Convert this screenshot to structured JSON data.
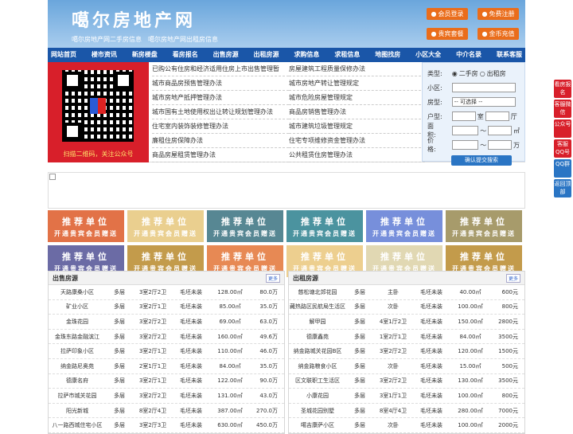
{
  "site": {
    "name": "噶尔房地产网",
    "sub_links": [
      "噶尔房地产网二手房信息",
      "噶尔房地产网出租房信息"
    ]
  },
  "header_buttons": {
    "login": "会员登录",
    "register": "免费注册",
    "vip": "贵宾套餐",
    "recharge": "金币充值"
  },
  "nav": [
    "网站首页",
    "楼市资讯",
    "新房楼盘",
    "看房报名",
    "出售房源",
    "出租房源",
    "求购信息",
    "求租信息",
    "地图找房",
    "小区大全",
    "中介名录",
    "联系客服"
  ],
  "qr": {
    "caption": "扫描二维码，关注公众号"
  },
  "news": [
    "已购公有住房和经济适用住房上市出售管理暂",
    "房屋建筑工程质量保修办法",
    "城市商品房预售管理办法",
    "城市房地产转让管理规定",
    "城市房地产抵押管理办法",
    "城市危险房屋管理规定",
    "城市国有土地使用权出让转让规划管理办法",
    "商品房销售管理办法",
    "住宅室内装饰装修管理办法",
    "城市建筑垃圾管理规定",
    "廉租住房保障办法",
    "住宅专项维修资金管理办法",
    "商品房屋租赁管理办法",
    "公共租赁住房管理办法"
  ],
  "search": {
    "type_label": "类型:",
    "type_sale": "二手房",
    "type_rent": "出租房",
    "community_label": "小区:",
    "house_type_label": "房型:",
    "house_type_value": "-- 可选择 --",
    "layout_label": "户型:",
    "room": "室",
    "hall": "厅",
    "area_label": "面积:",
    "area_unit": "㎡",
    "price_label": "价格:",
    "price_unit": "万",
    "button": "确认提交搜索"
  },
  "ads": {
    "title": "推荐单位",
    "subtitle": "开通贵宾会员赠送",
    "colors": [
      "#d9440a",
      "#e3c06a",
      "#1f5f6f",
      "#0f6f80",
      "#4a6ad0",
      "#8a7a3a",
      "#3a3a88",
      "#b07a10",
      "#e0621b",
      "#e8c06a",
      "#d8cc9a",
      "#b07a10"
    ]
  },
  "sale": {
    "title": "出售房源",
    "more": "更多",
    "rows": [
      [
        "天路康桑小区",
        "多层",
        "3室2厅2卫",
        "毛坯未装",
        "128.00㎡",
        "80.0万"
      ],
      [
        "矿业小区",
        "多层",
        "3室2厅1卫",
        "毛坯未装",
        "85.00㎡",
        "35.0万"
      ],
      [
        "金珠花园",
        "多层",
        "3室2厅2卫",
        "毛坯未装",
        "69.00㎡",
        "63.0万"
      ],
      [
        "金珠东路金融滨江",
        "多层",
        "3室2厅2卫",
        "毛坯未装",
        "160.00㎡",
        "49.6万"
      ],
      [
        "拉萨印象小区",
        "多层",
        "3室2厅1卫",
        "毛坯未装",
        "110.00㎡",
        "46.0万"
      ],
      [
        "纳金路尼奥苑",
        "多层",
        "2室1厅1卫",
        "毛坯未装",
        "84.00㎡",
        "35.0万"
      ],
      [
        "德康名府",
        "多层",
        "3室2厅1卫",
        "毛坯未装",
        "122.00㎡",
        "90.0万"
      ],
      [
        "拉萨市城关花园",
        "多层",
        "3室2厅2卫",
        "毛坯未装",
        "131.00㎡",
        "43.0万"
      ],
      [
        "阳光新城",
        "多层",
        "8室2厅4卫",
        "毛坯未装",
        "387.00㎡",
        "270.0万"
      ],
      [
        "八一路西城住宅小区",
        "多层",
        "3室2厅3卫",
        "毛坯未装",
        "630.00㎡",
        "450.0万"
      ]
    ]
  },
  "rent": {
    "title": "出租房源",
    "more": "更多",
    "rows": [
      [
        "慈松塘北郊花园",
        "多层",
        "主卧",
        "毛坯未装",
        "40.00㎡",
        "600元"
      ],
      [
        "藏热路区民航局生活区",
        "多层",
        "次卧",
        "毛坯未装",
        "100.00㎡",
        "800元"
      ],
      [
        "解甲园",
        "多层",
        "4室1厅2卫",
        "毛坯未装",
        "150.00㎡",
        "2800元"
      ],
      [
        "德康鑫苑",
        "多层",
        "1室2厅1卫",
        "毛坯未装",
        "84.00㎡",
        "3500元"
      ],
      [
        "纳金路城关花园B区",
        "多层",
        "3室2厅2卫",
        "毛坯未装",
        "120.00㎡",
        "1500元"
      ],
      [
        "纳金路粮食小区",
        "多层",
        "次卧",
        "毛坯未装",
        "15.00㎡",
        "500元"
      ],
      [
        "区文联职工生活区",
        "多层",
        "3室2厅2卫",
        "毛坯未装",
        "130.00㎡",
        "3500元"
      ],
      [
        "小康花园",
        "多层",
        "3室1厅1卫",
        "毛坯未装",
        "100.00㎡",
        "800元"
      ],
      [
        "圣城花园别墅",
        "多层",
        "8室4厅4卫",
        "毛坯未装",
        "280.00㎡",
        "7000元"
      ],
      [
        "噶吉康萨小区",
        "多层",
        "次卧",
        "毛坯未装",
        "100.00㎡",
        "2000元"
      ]
    ]
  },
  "sidebar": [
    "看房报名",
    "客服微信",
    "公众号",
    "客服QQ号",
    "QQ群",
    "返回顶部"
  ]
}
